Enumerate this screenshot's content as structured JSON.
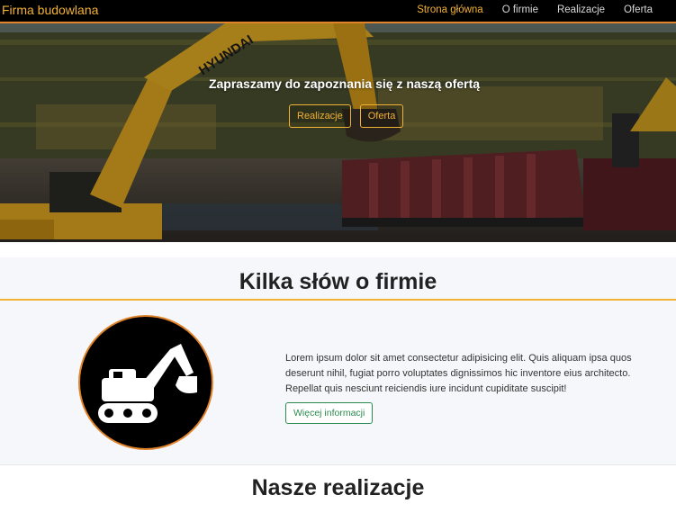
{
  "nav": {
    "brand": "Firma budowlana",
    "items": [
      {
        "label": "Strona główna",
        "active": true
      },
      {
        "label": "O firmie",
        "active": false
      },
      {
        "label": "Realizacje",
        "active": false
      },
      {
        "label": "Oferta",
        "active": false
      }
    ]
  },
  "hero": {
    "title": "Zapraszamy do zapoznania się z naszą ofertą",
    "buttons": [
      "Realizacje",
      "Oferta"
    ],
    "excavator_brand": "HYUNDAI"
  },
  "about": {
    "heading": "Kilka słów o firmie",
    "text": "Lorem ipsum dolor sit amet consectetur adipisicing elit. Quis aliquam ipsa quos deserunt nihil, fugiat porro voluptates dignissimos hic inventore eius architecto. Repellat quis nesciunt reiciendis iure incidunt cupiditate suscipit!",
    "button": "Więcej informacji",
    "icon": "excavator-icon"
  },
  "realizations": {
    "heading": "Nasze realizacje"
  },
  "colors": {
    "accent": "#f2b233",
    "orange": "#e0832a",
    "green": "#2b8a4e",
    "navbar": "#000000"
  }
}
